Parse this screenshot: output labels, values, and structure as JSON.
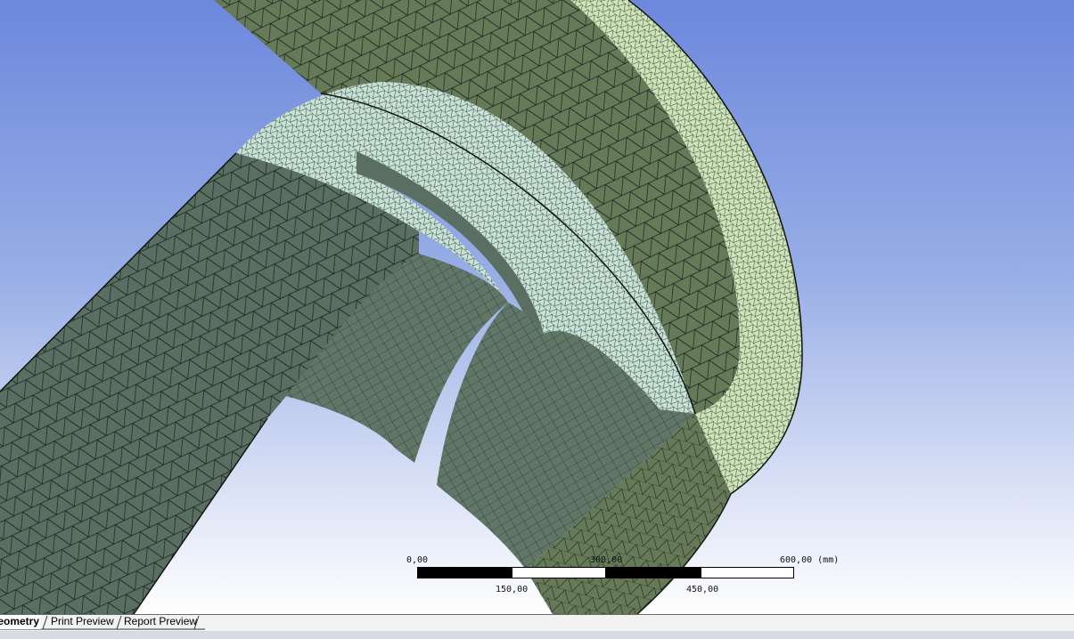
{
  "scale": {
    "unit": "(mm)",
    "top_labels": [
      "0,00",
      "300,00",
      "600,00"
    ],
    "bottom_labels": [
      "150,00",
      "450,00"
    ]
  },
  "tabs": [
    {
      "label": "Geometry",
      "active": true
    },
    {
      "label": "Print Preview",
      "active": false
    },
    {
      "label": "Report Preview",
      "active": false
    }
  ],
  "colors": {
    "mesh_dark": "#5a6e62",
    "mesh_mid": "#617667",
    "mesh_light": "#c7e2d6",
    "mesh_rim": "#cde3b8",
    "mesh_olive": "#667a58",
    "edge": "#1b2320"
  }
}
